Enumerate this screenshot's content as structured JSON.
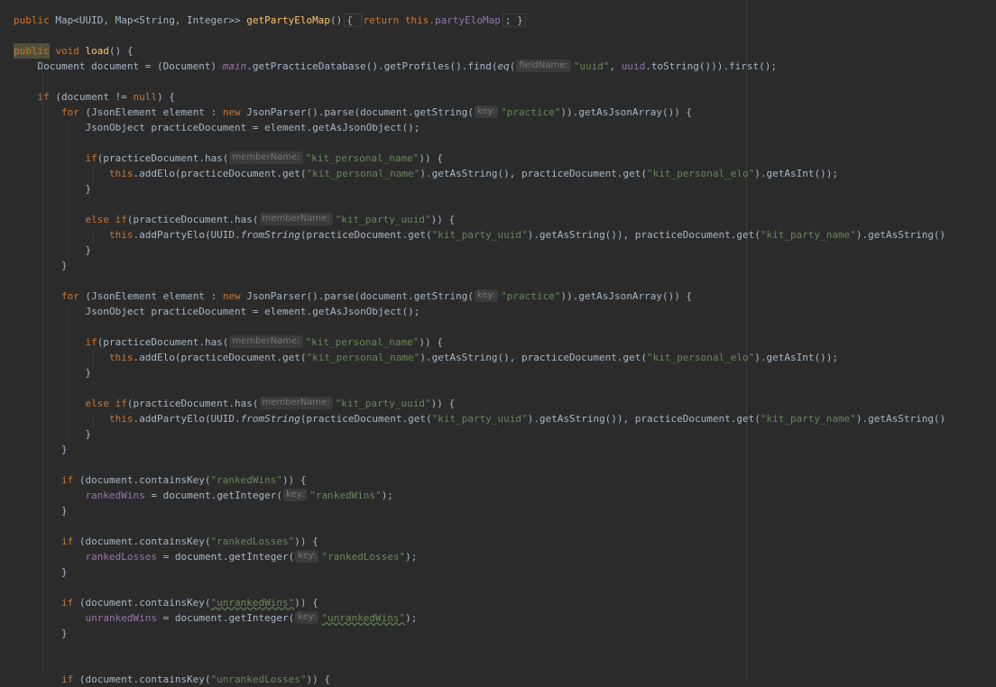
{
  "editor": {
    "lines": [
      [
        {
          "t": "public ",
          "c": "kw"
        },
        {
          "t": "Map<UUID, Map<String, Integer>> "
        },
        {
          "t": "getPartyEloMap",
          "c": "fn"
        },
        {
          "t": "()"
        },
        {
          "t": "{ ",
          "c": "fold"
        },
        {
          "t": "return this.",
          "c": "kw"
        },
        {
          "t": "partyEloMap",
          "c": "fld"
        },
        {
          "t": "; }",
          "c": "fold"
        }
      ],
      [],
      [
        {
          "t": "public",
          "c": "kw hl"
        },
        {
          "t": " void ",
          "c": "kw"
        },
        {
          "t": "load",
          "c": "fn"
        },
        {
          "t": "() {"
        }
      ],
      [
        {
          "t": "    Document document = (Document) "
        },
        {
          "t": "main",
          "c": "fld ital"
        },
        {
          "t": ".getPracticeDatabase().getProfiles().find("
        },
        {
          "t": "eq",
          "c": "ital"
        },
        {
          "t": "("
        },
        {
          "h": "fieldName:"
        },
        {
          "t": "\"uuid\"",
          "c": "str"
        },
        {
          "t": ", "
        },
        {
          "t": "uuid",
          "c": "fld"
        },
        {
          "t": ".toString())).first();"
        }
      ],
      [],
      [
        {
          "t": "    "
        },
        {
          "t": "if",
          "c": "kw"
        },
        {
          "t": " (document != "
        },
        {
          "t": "null",
          "c": "kw"
        },
        {
          "t": ") {"
        }
      ],
      [
        {
          "t": "        "
        },
        {
          "t": "for",
          "c": "kw"
        },
        {
          "t": " (JsonElement element : "
        },
        {
          "t": "new",
          "c": "kw"
        },
        {
          "t": " JsonParser().parse(document.getString("
        },
        {
          "h": "key:"
        },
        {
          "t": "\"practice\"",
          "c": "str"
        },
        {
          "t": ")).getAsJsonArray()) {"
        }
      ],
      [
        {
          "t": "            JsonObject practiceDocument = element.getAsJsonObject();"
        }
      ],
      [],
      [
        {
          "t": "            "
        },
        {
          "t": "if",
          "c": "kw"
        },
        {
          "t": "(practiceDocument.has("
        },
        {
          "h": "memberName:"
        },
        {
          "t": "\"kit_personal_name\"",
          "c": "str"
        },
        {
          "t": ")) {"
        }
      ],
      [
        {
          "t": "                "
        },
        {
          "t": "this",
          "c": "kw"
        },
        {
          "t": ".addElo(practiceDocument.get("
        },
        {
          "t": "\"kit_personal_name\"",
          "c": "str"
        },
        {
          "t": ").getAsString(), practiceDocument.get("
        },
        {
          "t": "\"kit_personal_elo\"",
          "c": "str"
        },
        {
          "t": ").getAsInt());"
        }
      ],
      [
        {
          "t": "            }"
        }
      ],
      [],
      [
        {
          "t": "            "
        },
        {
          "t": "else if",
          "c": "kw"
        },
        {
          "t": "(practiceDocument.has("
        },
        {
          "h": "memberName:"
        },
        {
          "t": "\"kit_party_uuid\"",
          "c": "str"
        },
        {
          "t": ")) {"
        }
      ],
      [
        {
          "t": "                "
        },
        {
          "t": "this",
          "c": "kw"
        },
        {
          "t": ".addPartyElo(UUID."
        },
        {
          "t": "fromString",
          "c": "ital"
        },
        {
          "t": "(practiceDocument.get("
        },
        {
          "t": "\"kit_party_uuid\"",
          "c": "str"
        },
        {
          "t": ").getAsString()), practiceDocument.get("
        },
        {
          "t": "\"kit_party_name\"",
          "c": "str"
        },
        {
          "t": ").getAsString()"
        }
      ],
      [
        {
          "t": "            }"
        }
      ],
      [
        {
          "t": "        }"
        }
      ],
      [],
      [
        {
          "t": "        "
        },
        {
          "t": "for",
          "c": "kw"
        },
        {
          "t": " (JsonElement element : "
        },
        {
          "t": "new",
          "c": "kw"
        },
        {
          "t": " JsonParser().parse(document.getString("
        },
        {
          "h": "key:"
        },
        {
          "t": "\"practice\"",
          "c": "str"
        },
        {
          "t": ")).getAsJsonArray()) {"
        }
      ],
      [
        {
          "t": "            JsonObject practiceDocument = element.getAsJsonObject();"
        }
      ],
      [],
      [
        {
          "t": "            "
        },
        {
          "t": "if",
          "c": "kw"
        },
        {
          "t": "(practiceDocument.has("
        },
        {
          "h": "memberName:"
        },
        {
          "t": "\"kit_personal_name\"",
          "c": "str"
        },
        {
          "t": ")) {"
        }
      ],
      [
        {
          "t": "                "
        },
        {
          "t": "this",
          "c": "kw"
        },
        {
          "t": ".addElo(practiceDocument.get("
        },
        {
          "t": "\"kit_personal_name\"",
          "c": "str"
        },
        {
          "t": ").getAsString(), practiceDocument.get("
        },
        {
          "t": "\"kit_personal_elo\"",
          "c": "str"
        },
        {
          "t": ").getAsInt());"
        }
      ],
      [
        {
          "t": "            }"
        }
      ],
      [],
      [
        {
          "t": "            "
        },
        {
          "t": "else if",
          "c": "kw"
        },
        {
          "t": "(practiceDocument.has("
        },
        {
          "h": "memberName:"
        },
        {
          "t": "\"kit_party_uuid\"",
          "c": "str"
        },
        {
          "t": ")) {"
        }
      ],
      [
        {
          "t": "                "
        },
        {
          "t": "this",
          "c": "kw"
        },
        {
          "t": ".addPartyElo(UUID."
        },
        {
          "t": "fromString",
          "c": "ital"
        },
        {
          "t": "(practiceDocument.get("
        },
        {
          "t": "\"kit_party_uuid\"",
          "c": "str"
        },
        {
          "t": ").getAsString()), practiceDocument.get("
        },
        {
          "t": "\"kit_party_name\"",
          "c": "str"
        },
        {
          "t": ").getAsString()"
        }
      ],
      [
        {
          "t": "            }"
        }
      ],
      [
        {
          "t": "        }"
        }
      ],
      [],
      [
        {
          "t": "        "
        },
        {
          "t": "if",
          "c": "kw"
        },
        {
          "t": " (document.containsKey("
        },
        {
          "t": "\"rankedWins\"",
          "c": "str"
        },
        {
          "t": ")) {"
        }
      ],
      [
        {
          "t": "            "
        },
        {
          "t": "rankedWins",
          "c": "fld"
        },
        {
          "t": " = document.getInteger("
        },
        {
          "h": "key:"
        },
        {
          "t": "\"rankedWins\"",
          "c": "str"
        },
        {
          "t": ");"
        }
      ],
      [
        {
          "t": "        }"
        }
      ],
      [],
      [
        {
          "t": "        "
        },
        {
          "t": "if",
          "c": "kw"
        },
        {
          "t": " (document.containsKey("
        },
        {
          "t": "\"rankedLosses\"",
          "c": "str"
        },
        {
          "t": ")) {"
        }
      ],
      [
        {
          "t": "            "
        },
        {
          "t": "rankedLosses",
          "c": "fld"
        },
        {
          "t": " = document.getInteger("
        },
        {
          "h": "key:"
        },
        {
          "t": "\"rankedLosses\"",
          "c": "str"
        },
        {
          "t": ");"
        }
      ],
      [
        {
          "t": "        }"
        }
      ],
      [],
      [
        {
          "t": "        "
        },
        {
          "t": "if",
          "c": "kw"
        },
        {
          "t": " (document.containsKey("
        },
        {
          "t": "\"unrankedWins\"",
          "c": "str sq"
        },
        {
          "t": ")) {"
        }
      ],
      [
        {
          "t": "            "
        },
        {
          "t": "unrankedWins",
          "c": "fld"
        },
        {
          "t": " = document.getInteger("
        },
        {
          "h": "key:"
        },
        {
          "t": "\"unrankedWins\"",
          "c": "str sq"
        },
        {
          "t": ");"
        }
      ],
      [
        {
          "t": "        }"
        }
      ],
      [],
      [],
      [
        {
          "t": "        "
        },
        {
          "t": "if",
          "c": "kw"
        },
        {
          "t": " (document.containsKey("
        },
        {
          "t": "\"unrankedLosses\"",
          "c": "str"
        },
        {
          "t": ")) {"
        }
      ]
    ]
  },
  "colors": {
    "background": "#2b2b2b",
    "keyword": "#cc7832",
    "method": "#ffc66d",
    "string": "#6a8759",
    "field": "#9876aa",
    "text": "#a9b7c6"
  }
}
